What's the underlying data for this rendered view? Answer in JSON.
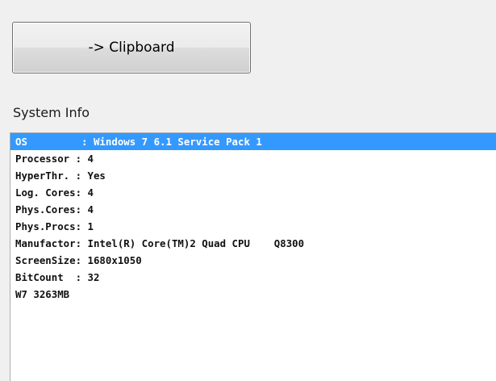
{
  "toolbar": {
    "clipboard_label": "-> Clipboard"
  },
  "system_info": {
    "label": "System Info",
    "rows": [
      "OS         : Windows 7 6.1 Service Pack 1",
      "Processor : 4",
      "HyperThr. : Yes",
      "Log. Cores: 4",
      "Phys.Cores: 4",
      "Phys.Procs: 1",
      "Manufactor: Intel(R) Core(TM)2 Quad CPU    Q8300",
      "ScreenSize: 1680x1050",
      "BitCount  : 32",
      "W7 3263MB"
    ],
    "selected_index": 0
  },
  "colors": {
    "selection": "#3399ff",
    "window_bg": "#f0f0f0",
    "list_bg": "#ffffff"
  }
}
